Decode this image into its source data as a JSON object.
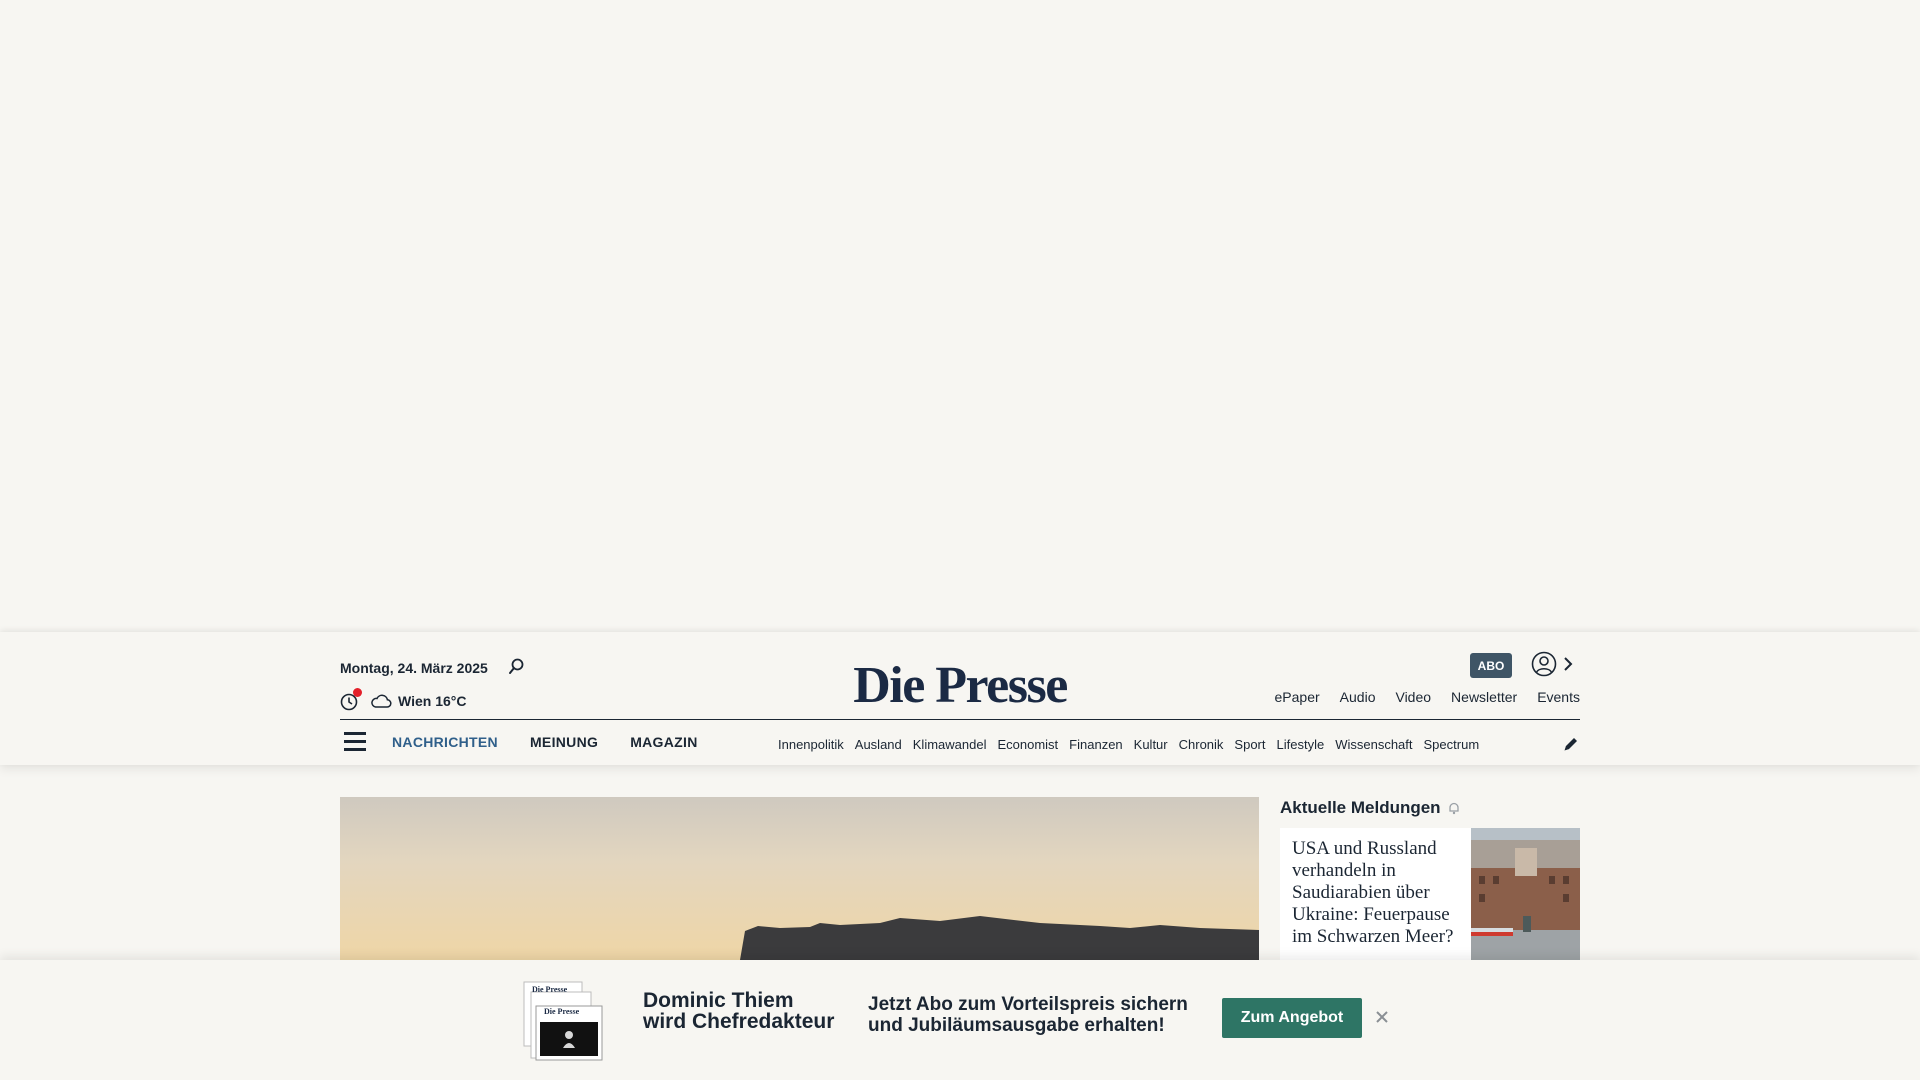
{
  "colors": {
    "background": "#f7f6f2",
    "text": "#1b2633",
    "logo": "#1b2a44",
    "nav_active": "#2f5f8a",
    "abo_badge": "#3f5566",
    "notification_dot": "#e3202a",
    "cta_button": "#2e7565"
  },
  "header": {
    "date": "Montag, 24. März 2025",
    "search_icon": "search-icon",
    "history_icon": "history-icon",
    "weather": {
      "icon": "cloud-icon",
      "text": "Wien 16°C"
    },
    "logo": "Die Presse",
    "abo_label": "ABO",
    "account_icon": "user-icon",
    "service_links": [
      "ePaper",
      "Audio",
      "Video",
      "Newsletter",
      "Events"
    ]
  },
  "nav": {
    "menu_icon": "hamburger-icon",
    "main": [
      {
        "label": "NACHRICHTEN",
        "active": true
      },
      {
        "label": "MEINUNG",
        "active": false
      },
      {
        "label": "MAGAZIN",
        "active": false
      }
    ],
    "sections": [
      "Innenpolitik",
      "Ausland",
      "Klimawandel",
      "Economist",
      "Finanzen",
      "Kultur",
      "Chronik",
      "Sport",
      "Lifestyle",
      "Wissenschaft",
      "Spectrum"
    ],
    "edit_icon": "pencil-icon"
  },
  "news": {
    "title": "Aktuelle Meldungen",
    "title_icon": "bell-icon",
    "items": [
      {
        "headline": "USA und Russland verhandeln in Saudiarabien über Ukraine: Feuerpause im Schwarzen Meer?"
      }
    ]
  },
  "promo": {
    "headline_line1": "Dominic Thiem",
    "headline_line2": "wird Chefredakteur",
    "text_line1": "Jetzt Abo zum Vorteilspreis sichern",
    "text_line2": "und Jubiläumsausgabe erhalten!",
    "cta": "Zum Angebot",
    "close_icon": "close-icon",
    "paper_mini_logo": "Die Presse"
  }
}
